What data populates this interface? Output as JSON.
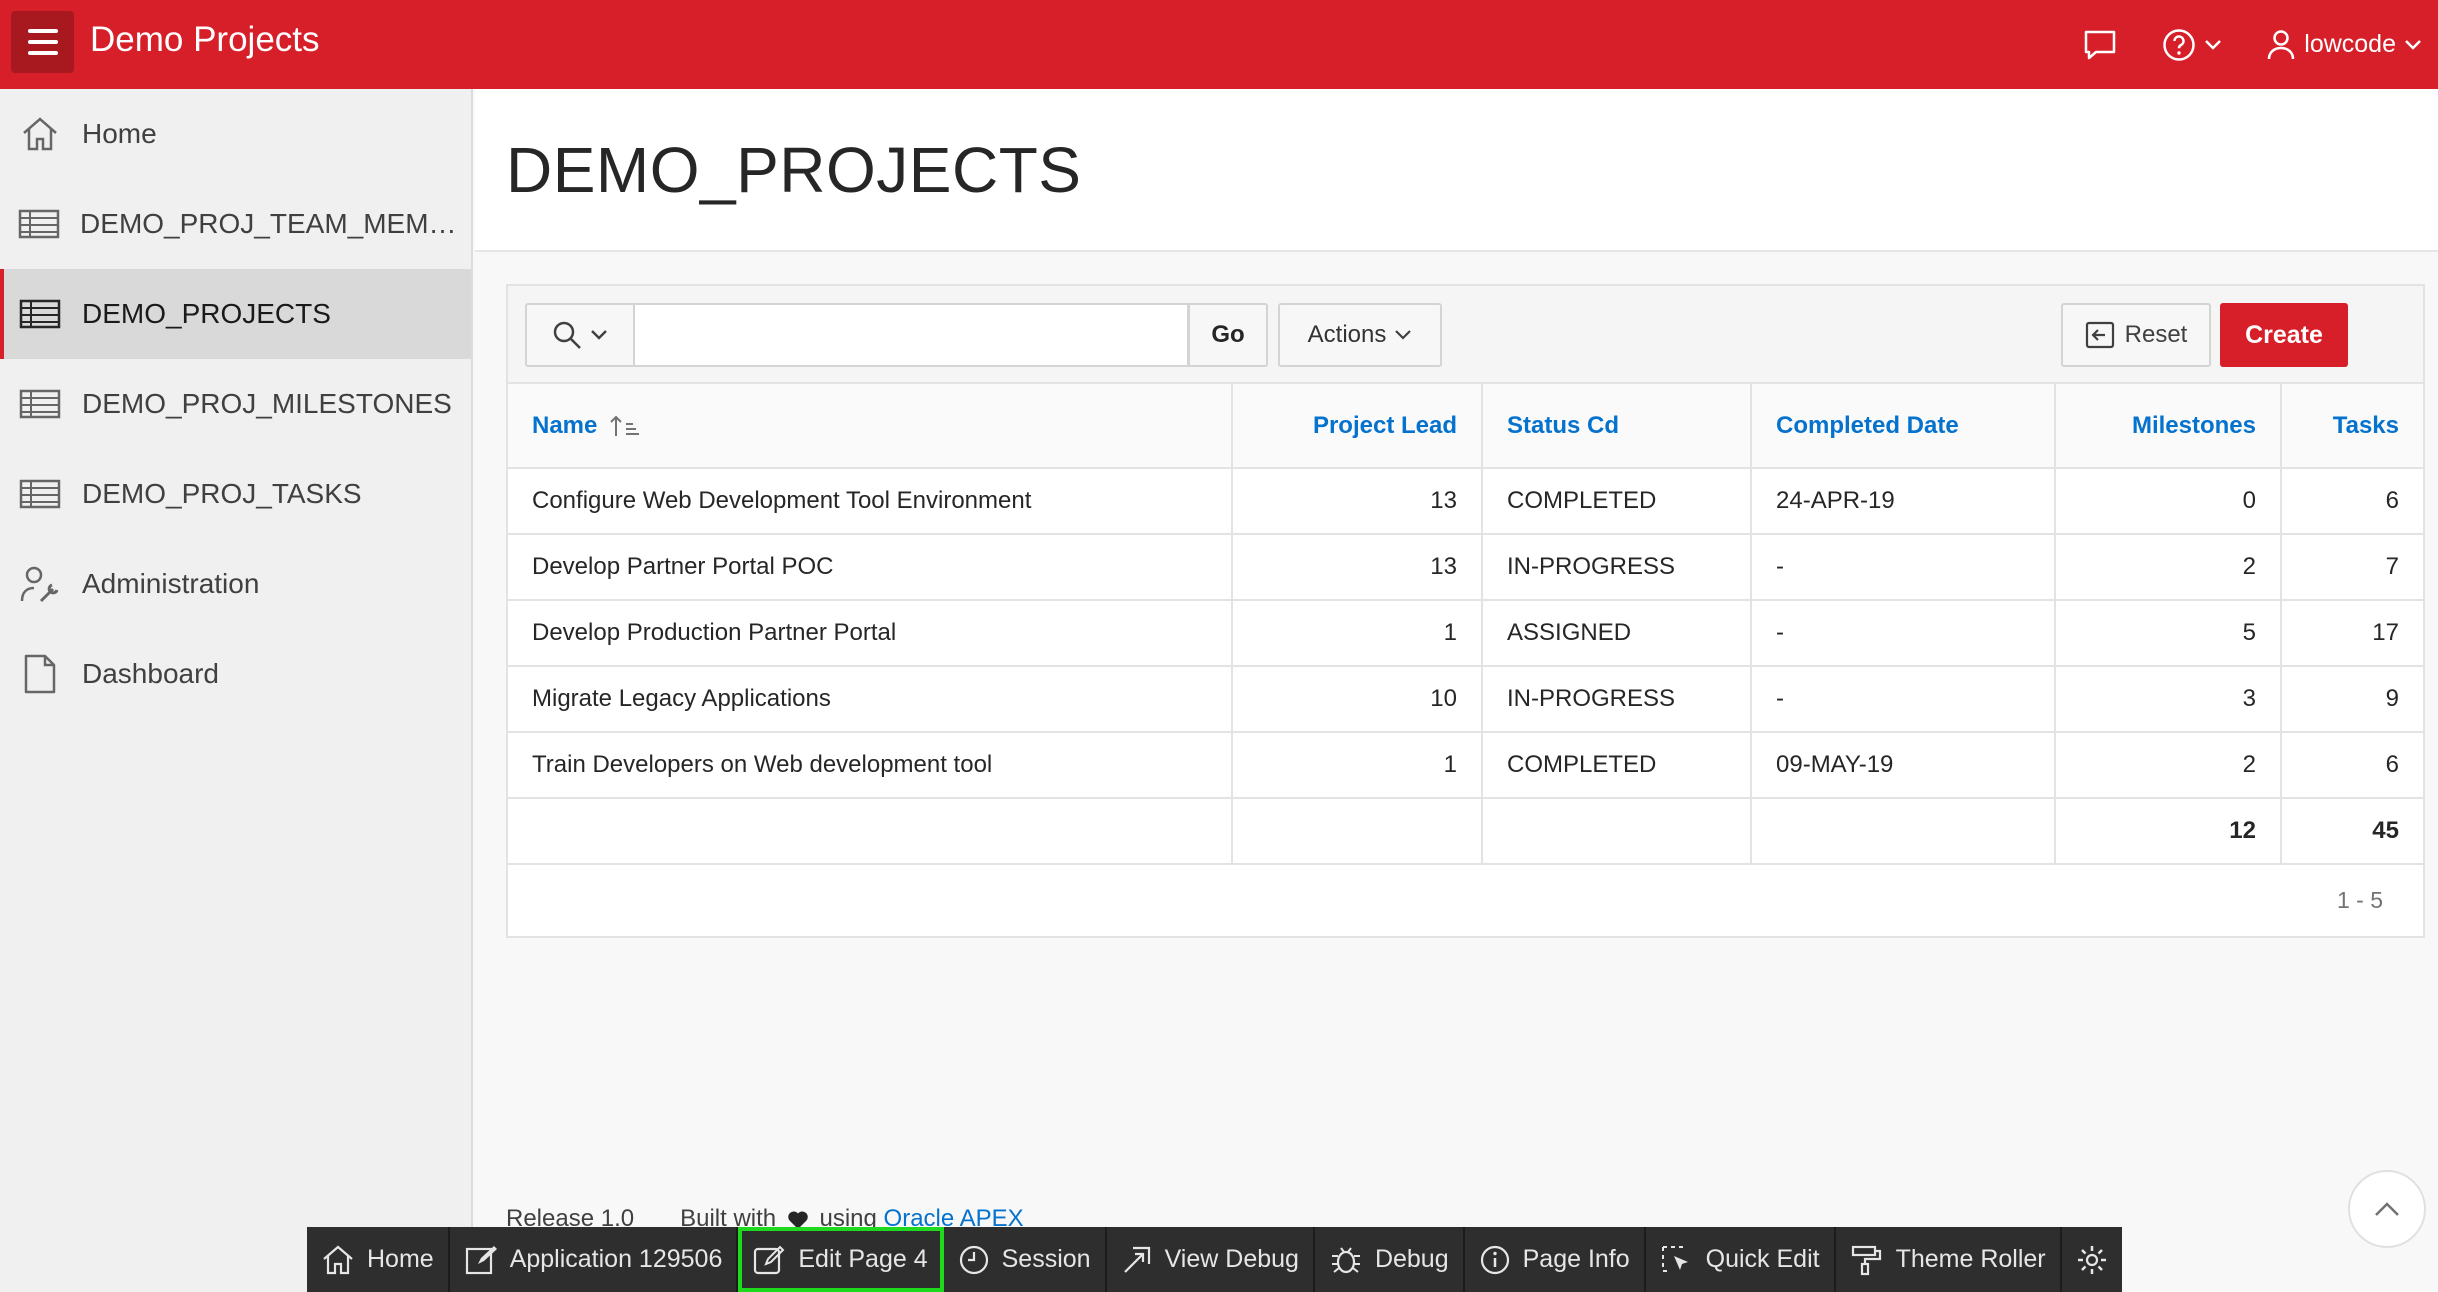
{
  "app": {
    "title": "Demo Projects",
    "user": "lowcode"
  },
  "sidebar": {
    "items": [
      {
        "label": "Home",
        "icon": "home-icon",
        "active": false
      },
      {
        "label": "DEMO_PROJ_TEAM_MEMBE...",
        "icon": "table-icon",
        "active": false
      },
      {
        "label": "DEMO_PROJECTS",
        "icon": "table-icon",
        "active": true
      },
      {
        "label": "DEMO_PROJ_MILESTONES",
        "icon": "table-icon",
        "active": false
      },
      {
        "label": "DEMO_PROJ_TASKS",
        "icon": "table-icon",
        "active": false
      },
      {
        "label": "Administration",
        "icon": "user-wrench-icon",
        "active": false
      },
      {
        "label": "Dashboard",
        "icon": "file-icon",
        "active": false
      }
    ]
  },
  "page": {
    "title": "DEMO_PROJECTS"
  },
  "toolbar": {
    "search_value": "",
    "go_label": "Go",
    "actions_label": "Actions",
    "reset_label": "Reset",
    "create_label": "Create"
  },
  "grid": {
    "columns": [
      "Name",
      "Project Lead",
      "Status Cd",
      "Completed Date",
      "Milestones",
      "Tasks"
    ],
    "rows": [
      [
        "Configure Web Development Tool Environment",
        "13",
        "COMPLETED",
        "24-APR-19",
        "0",
        "6"
      ],
      [
        "Develop Partner Portal POC",
        "13",
        "IN-PROGRESS",
        "-",
        "2",
        "7"
      ],
      [
        "Develop Production Partner Portal",
        "1",
        "ASSIGNED",
        "-",
        "5",
        "17"
      ],
      [
        "Migrate Legacy Applications",
        "10",
        "IN-PROGRESS",
        "-",
        "3",
        "9"
      ],
      [
        "Train Developers on Web development tool",
        "1",
        "COMPLETED",
        "09-MAY-19",
        "2",
        "6"
      ]
    ],
    "totals": {
      "milestones": "12",
      "tasks": "45"
    },
    "pagination": "1 - 5"
  },
  "footer": {
    "release": "Release 1.0",
    "built_with": "Built with",
    "using": "using",
    "link": "Oracle APEX"
  },
  "devbar": {
    "items": [
      {
        "label": "Home",
        "icon": "home-icon"
      },
      {
        "label": "Application 129506",
        "icon": "edit-app-icon"
      },
      {
        "label": "Edit Page 4",
        "icon": "edit-page-icon"
      },
      {
        "label": "Session",
        "icon": "clock-icon"
      },
      {
        "label": "View Debug",
        "icon": "view-debug-icon"
      },
      {
        "label": "Debug",
        "icon": "bug-icon"
      },
      {
        "label": "Page Info",
        "icon": "info-icon"
      },
      {
        "label": "Quick Edit",
        "icon": "quick-edit-icon"
      },
      {
        "label": "Theme Roller",
        "icon": "paint-roller-icon"
      }
    ]
  },
  "colors": {
    "brand": "#d71f29",
    "link": "#0572ce",
    "highlight": "#1ed91e"
  }
}
